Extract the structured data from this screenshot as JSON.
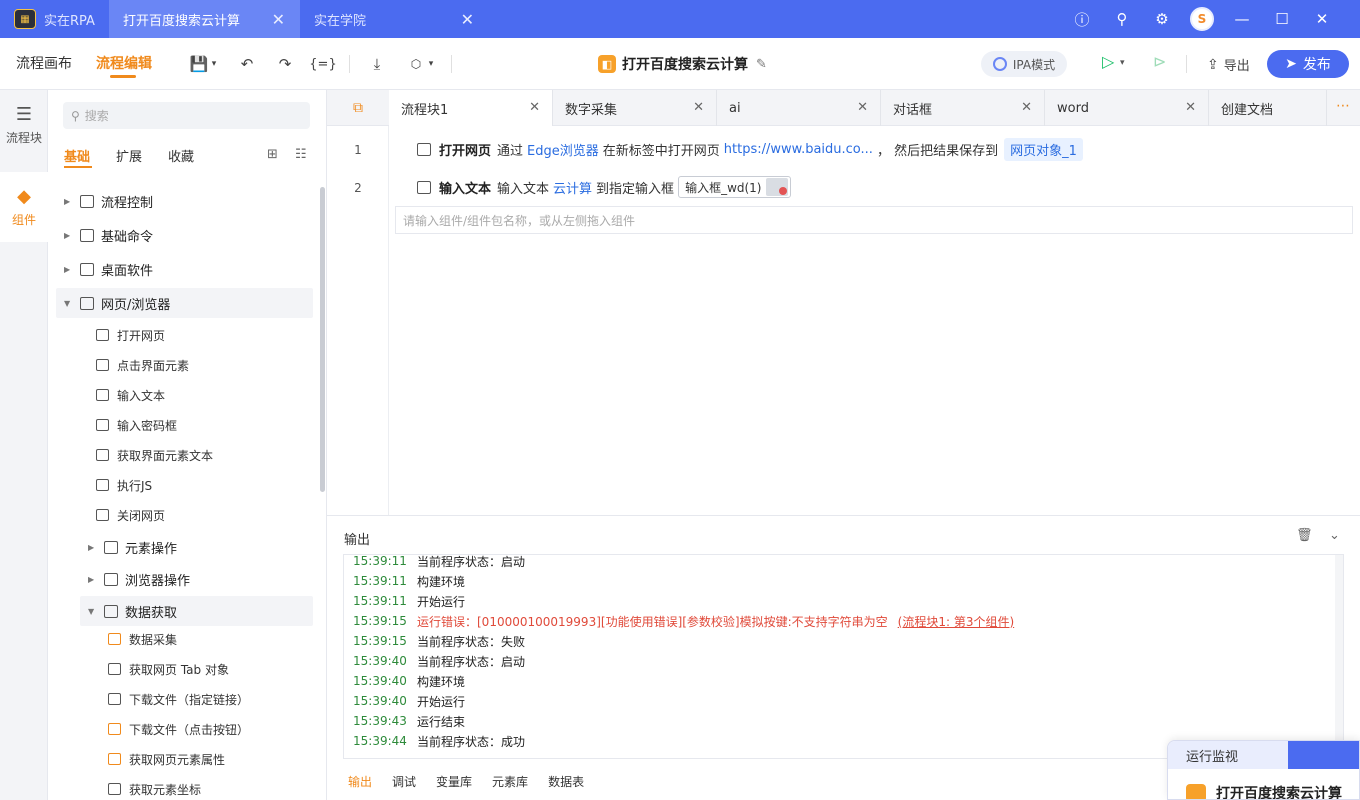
{
  "titlebar": {
    "app_name": "实在RPA",
    "tabs": [
      {
        "label": "打开百度搜索云计算",
        "active": true
      },
      {
        "label": "实在学院",
        "active": false
      }
    ],
    "icons": [
      "help-icon",
      "search-icon",
      "settings-icon",
      "avatar",
      "minimize-icon",
      "maximize-icon",
      "close-icon"
    ]
  },
  "toolbar": {
    "tabs": [
      {
        "label": "流程画布",
        "active": false
      },
      {
        "label": "流程编辑",
        "active": true
      }
    ],
    "doc_title": "打开百度搜索云计算",
    "ipa_mode": "IPA模式",
    "export": "导出",
    "publish": "发布"
  },
  "rail": {
    "items": [
      {
        "label": "流程块",
        "active": false
      },
      {
        "label": "组件",
        "active": true
      }
    ]
  },
  "panel": {
    "search_placeholder": "搜索",
    "categories": [
      {
        "label": "基础",
        "active": true
      },
      {
        "label": "扩展",
        "active": false
      },
      {
        "label": "收藏",
        "active": false
      }
    ],
    "tree": [
      {
        "label": "流程控制",
        "expanded": false
      },
      {
        "label": "基础命令",
        "expanded": false
      },
      {
        "label": "桌面软件",
        "expanded": false
      },
      {
        "label": "网页/浏览器",
        "expanded": true
      }
    ],
    "browser_items": [
      "打开网页",
      "点击界面元素",
      "输入文本",
      "输入密码框",
      "获取界面元素文本",
      "执行JS",
      "关闭网页"
    ],
    "sub_groups": [
      {
        "label": "元素操作",
        "expanded": false
      },
      {
        "label": "浏览器操作",
        "expanded": false
      },
      {
        "label": "数据获取",
        "expanded": true
      }
    ],
    "data_items": [
      "数据采集",
      "获取网页 Tab 对象",
      "下载文件（指定链接）",
      "下载文件（点击按钮）",
      "获取网页元素属性",
      "获取元素坐标"
    ]
  },
  "editor": {
    "tabs": [
      {
        "label": "流程块1",
        "active": true
      },
      {
        "label": "数字采集",
        "active": false
      },
      {
        "label": "ai",
        "active": false
      },
      {
        "label": "对话框",
        "active": false
      },
      {
        "label": "word",
        "active": false
      },
      {
        "label": "创建文档",
        "active": false
      }
    ],
    "steps": [
      {
        "line": "1",
        "name": "打开网页",
        "t1": "通过",
        "browser": "Edge浏览器",
        "t2": "在新标签中打开网页",
        "url": "https://www.baidu.co...",
        "t3": "，  然后把结果保存到",
        "result": "网页对象_1"
      },
      {
        "line": "2",
        "name": "输入文本",
        "t1": "输入文本",
        "text": "云计算",
        "t2": "到指定输入框",
        "element": "输入框_wd(1)"
      }
    ],
    "add_placeholder": "请输入组件/组件包名称，或从左侧拖入组件"
  },
  "output": {
    "title": "输出",
    "logs": [
      {
        "time": "15:39:11",
        "msg": "当前程序状态：启动",
        "error": false
      },
      {
        "time": "15:39:11",
        "msg": "构建环境",
        "error": false
      },
      {
        "time": "15:39:11",
        "msg": "开始运行",
        "error": false
      },
      {
        "time": "15:39:15",
        "msg": "运行错误：[010000100019993][功能使用错误][参数校验]模拟按键:不支持字符串为空",
        "link": "(流程块1: 第3个组件)",
        "error": true
      },
      {
        "time": "15:39:15",
        "msg": "当前程序状态：失败",
        "error": false
      },
      {
        "time": "15:39:40",
        "msg": "当前程序状态：启动",
        "error": false
      },
      {
        "time": "15:39:40",
        "msg": "构建环境",
        "error": false
      },
      {
        "time": "15:39:40",
        "msg": "开始运行",
        "error": false
      },
      {
        "time": "15:39:43",
        "msg": "运行结束",
        "error": false
      },
      {
        "time": "15:39:44",
        "msg": "当前程序状态：成功",
        "error": false
      }
    ],
    "tabs": [
      {
        "label": "输出",
        "active": true
      },
      {
        "label": "调试",
        "active": false
      },
      {
        "label": "变量库",
        "active": false
      },
      {
        "label": "元素库",
        "active": false
      },
      {
        "label": "数据表",
        "active": false
      }
    ]
  },
  "monitor": {
    "title": "运行监视",
    "process": "打开百度搜索云计算"
  },
  "colors": {
    "brand_blue": "#4b6bf0",
    "accent_orange": "#f08a1c",
    "time_green": "#2d8a3a",
    "error_red": "#e04a3a"
  }
}
